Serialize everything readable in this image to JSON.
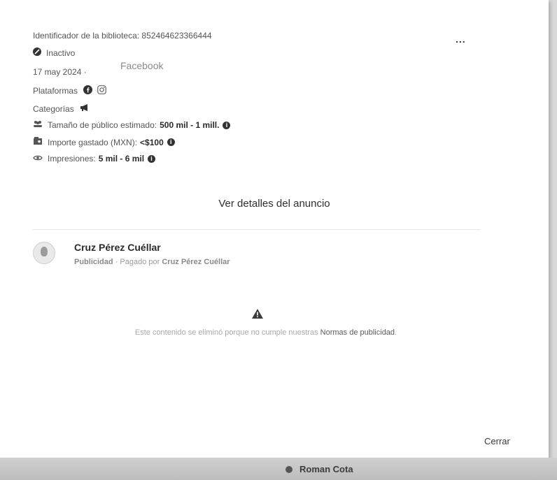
{
  "ad": {
    "library_id": "Identificador de la biblioteca: 852464623366444",
    "more_menu": "...",
    "status": "Inactivo",
    "date": "17 may 2024 ·",
    "platform_overlay": "Facebook",
    "platforms_label": "Plataformas",
    "categories_label": "Categorías",
    "audience_label": "Tamaño de público estimado:",
    "audience_value": "500 mil - 1 mill.",
    "spent_label": "Importe gastado (MXN):",
    "spent_value": "<$100",
    "impressions_label": "Impresiones:",
    "impressions_value": "5 mil - 6 mil",
    "details_link": "Ver detalles del anuncio"
  },
  "advertiser": {
    "name": "Cruz Pérez Cuéllar",
    "type": "Publicidad",
    "paid_by_prefix": " · Pagado por ",
    "paid_by": "Cruz Pérez Cuéllar"
  },
  "removed": {
    "message": "Este contenido se eliminó porque no cumple nuestras ",
    "message_link": "Normas de publicidad",
    "message_end": "."
  },
  "footer": {
    "close": "Cerrar"
  },
  "taskbar": {
    "user": "Roman Cota"
  },
  "icons": [
    "status-icon",
    "facebook-icon",
    "instagram-icon",
    "megaphone-icon",
    "audience-icon",
    "money-icon",
    "eye-icon",
    "info-icon",
    "warning-icon"
  ]
}
